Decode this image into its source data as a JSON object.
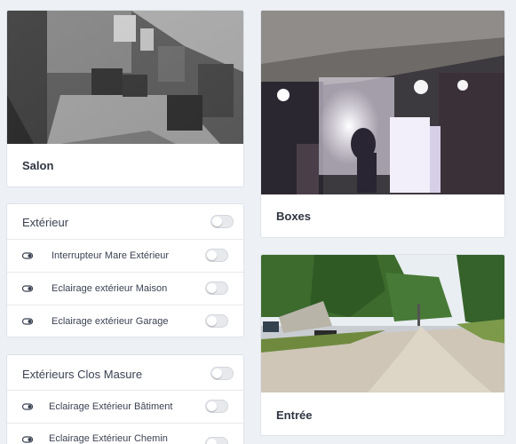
{
  "cameras": {
    "salon": {
      "title": "Salon",
      "icon": "camera-feed-indoor"
    },
    "boxes": {
      "title": "Boxes",
      "icon": "camera-feed-barn"
    },
    "entree": {
      "title": "Entrée",
      "icon": "camera-feed-driveway"
    }
  },
  "groups": {
    "exterieur": {
      "title": "Extérieur",
      "state": "off",
      "items": [
        {
          "label": "Interrupteur Mare Extérieur",
          "icon": "toggle-icon",
          "state": "off"
        },
        {
          "label": "Eclairage extérieur Maison",
          "icon": "toggle-icon",
          "state": "off"
        },
        {
          "label": "Eclairage extérieur Garage",
          "icon": "toggle-icon",
          "state": "off"
        }
      ]
    },
    "clos_masure": {
      "title": "Extérieurs Clos Masure",
      "state": "off",
      "items": [
        {
          "label": "Eclairage Extérieur Bâtiment",
          "icon": "toggle-icon",
          "state": "off"
        },
        {
          "label": "Eclairage Extérieur Chemin",
          "icon": "toggle-icon",
          "state": "off"
        }
      ]
    }
  },
  "colors": {
    "background": "#edf0f4",
    "card": "#ffffff",
    "border": "#dfe3e8",
    "text": "#2e3440"
  }
}
